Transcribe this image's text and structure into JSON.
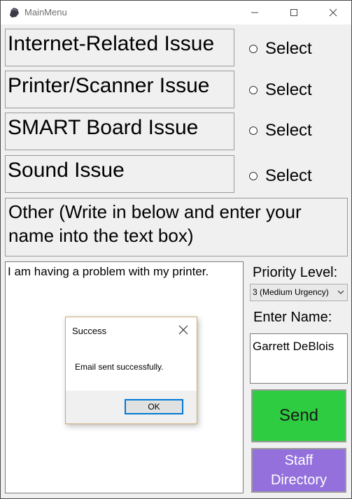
{
  "window": {
    "title": "MainMenu",
    "icon": "app-icon"
  },
  "issues": [
    {
      "label": "Internet-Related Issue",
      "radio_label": "Select",
      "selected": false
    },
    {
      "label": "Printer/Scanner Issue",
      "radio_label": "Select",
      "selected": false
    },
    {
      "label": "SMART Board Issue",
      "radio_label": "Select",
      "selected": false
    },
    {
      "label": "Sound Issue",
      "radio_label": "Select",
      "selected": false
    }
  ],
  "other": {
    "label_line1": "Other (Write in below and enter your",
    "label_line2": "name into the text box)"
  },
  "message": {
    "value": "I am having a problem with my printer."
  },
  "priority": {
    "label": "Priority Level:",
    "selected": "3 (Medium Urgency)"
  },
  "name": {
    "label": "Enter Name:",
    "value": "Garrett DeBlois"
  },
  "buttons": {
    "send": "Send",
    "staff_line1": "Staff",
    "staff_line2": "Directory"
  },
  "dialog": {
    "title": "Success",
    "message": "Email sent successfully.",
    "ok": "OK"
  },
  "colors": {
    "send_bg": "#2ecc40",
    "staff_bg": "#9370db",
    "ok_border": "#0078d7"
  }
}
